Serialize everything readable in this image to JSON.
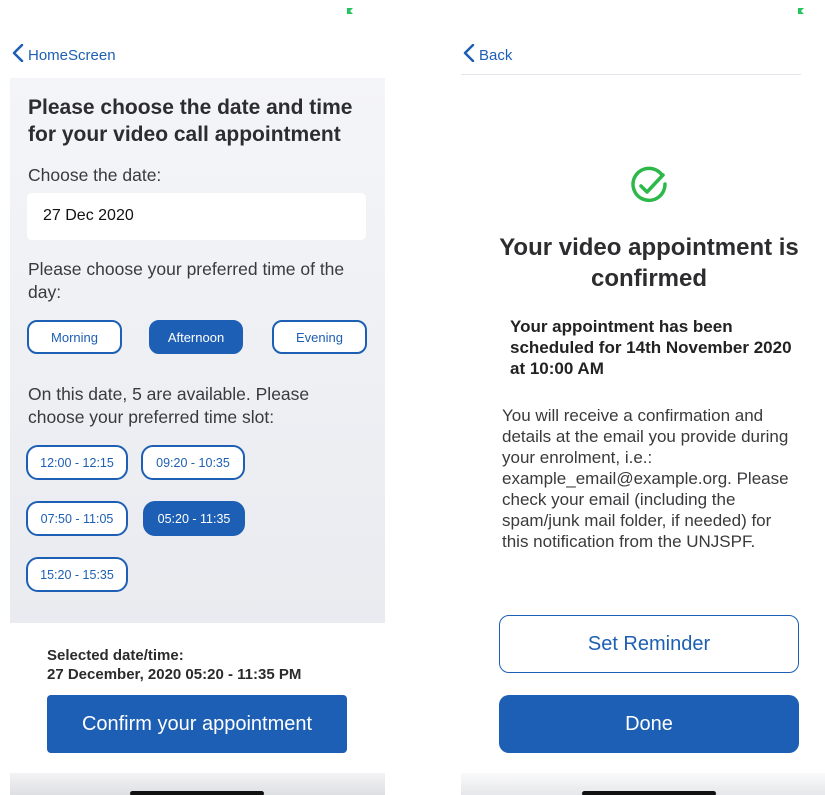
{
  "colors": {
    "accent": "#1d5fb4",
    "success": "#2db84a",
    "status": "#22c55e"
  },
  "left": {
    "nav": {
      "back_label": "HomeScreen",
      "back_icon": "chevron-left-icon"
    },
    "title": "Please choose the date and time for your video call appointment",
    "date_label": "Choose the date:",
    "date_value": "27 Dec 2020",
    "time_of_day_label": "Please choose your preferred time of the day:",
    "time_of_day_options": [
      {
        "label": "Morning",
        "selected": false
      },
      {
        "label": "Afternoon",
        "selected": true
      },
      {
        "label": "Evening",
        "selected": false
      }
    ],
    "slots_label": "On this date, 5 are available. Please choose your preferred time slot:",
    "slots": [
      {
        "label": "12:00 - 12:15",
        "selected": false
      },
      {
        "label": "09:20 - 10:35",
        "selected": false
      },
      {
        "label": "07:50 - 11:05",
        "selected": false
      },
      {
        "label": "05:20 - 11:35",
        "selected": true
      },
      {
        "label": "15:20 - 15:35",
        "selected": false
      }
    ],
    "selected_label": "Selected date/time:",
    "selected_value": "27 December, 2020 05:20 - 11:35 PM",
    "confirm_label": "Confirm your appointment"
  },
  "right": {
    "nav": {
      "back_label": "Back",
      "back_icon": "chevron-left-icon"
    },
    "icon": "check-circle-icon",
    "title": "Your video appointment is confirmed",
    "subtitle": "Your appointment has been scheduled for 14th November 2020 at 10:00 AM",
    "body": "You will receive a confirmation and details at the email you provide during your enrolment, i.e.: example_email@example.org. Please check your email (including the spam/junk mail folder, if needed) for this notification from the UNJSPF.",
    "reminder_label": "Set Reminder",
    "done_label": "Done"
  }
}
